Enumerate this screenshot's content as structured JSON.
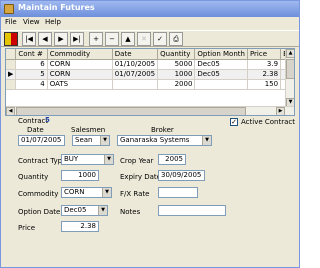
{
  "window": {
    "title": "Maintain Futures"
  },
  "menu": {
    "items": [
      "File",
      "View",
      "Help"
    ]
  },
  "toolbar": {
    "buttons": [
      {
        "icon": "flag-icon",
        "glyph": ""
      },
      {
        "icon": "first-record-icon",
        "glyph": "|◀"
      },
      {
        "icon": "previous-record-icon",
        "glyph": "◀"
      },
      {
        "icon": "next-record-icon",
        "glyph": "▶"
      },
      {
        "icon": "last-record-icon",
        "glyph": "▶|"
      },
      {
        "icon": "add-record-icon",
        "glyph": "+"
      },
      {
        "icon": "delete-record-icon",
        "glyph": "−"
      },
      {
        "icon": "edit-record-icon",
        "glyph": "▲"
      },
      {
        "icon": "cancel-icon",
        "glyph": "✕"
      },
      {
        "icon": "save-icon",
        "glyph": "✓"
      },
      {
        "icon": "print-icon",
        "glyph": "⎙"
      }
    ]
  },
  "grid": {
    "columns": [
      "Cont #",
      "Commodity",
      "Date",
      "Quantity",
      "Option Month",
      "Price",
      "B"
    ],
    "rows": [
      {
        "cont": "6",
        "commodity": "CORN",
        "date": "01/10/2005",
        "quantity": "5000",
        "option_month": "Dec05",
        "price": "3.9",
        "current": false
      },
      {
        "cont": "5",
        "commodity": "CORN",
        "date": "01/07/2005",
        "quantity": "1000",
        "option_month": "Dec05",
        "price": "2.38",
        "current": true
      },
      {
        "cont": "4",
        "commodity": "OATS",
        "date": "",
        "quantity": "2000",
        "option_month": "",
        "price": "150",
        "current": false
      }
    ]
  },
  "form": {
    "contract_label": "Contract",
    "contract_no": "5",
    "date_label": "Date",
    "date_value": "01/07/2005",
    "salesmen_label": "Salesmen",
    "salesmen_value": "Sean",
    "broker_label": "Broker",
    "broker_value": "Ganaraska Systems",
    "active_label": "Active Contract",
    "active_checked": "✓",
    "contract_type_label": "Contract Type",
    "contract_type_value": "BUY",
    "crop_year_label": "Crop Year",
    "crop_year_value": "2005",
    "quantity_label": "Quantity",
    "quantity_value": "1000",
    "expiry_label": "Expiry Date",
    "expiry_value": "30/09/2005",
    "commodity_label": "Commodity",
    "commodity_value": "CORN",
    "fx_label": "F/X Rate",
    "fx_value": "",
    "option_date_label": "Option Date",
    "option_date_value": "Dec05",
    "notes_label": "Notes",
    "notes_value": "",
    "price_label": "Price",
    "price_value": "2.38"
  }
}
